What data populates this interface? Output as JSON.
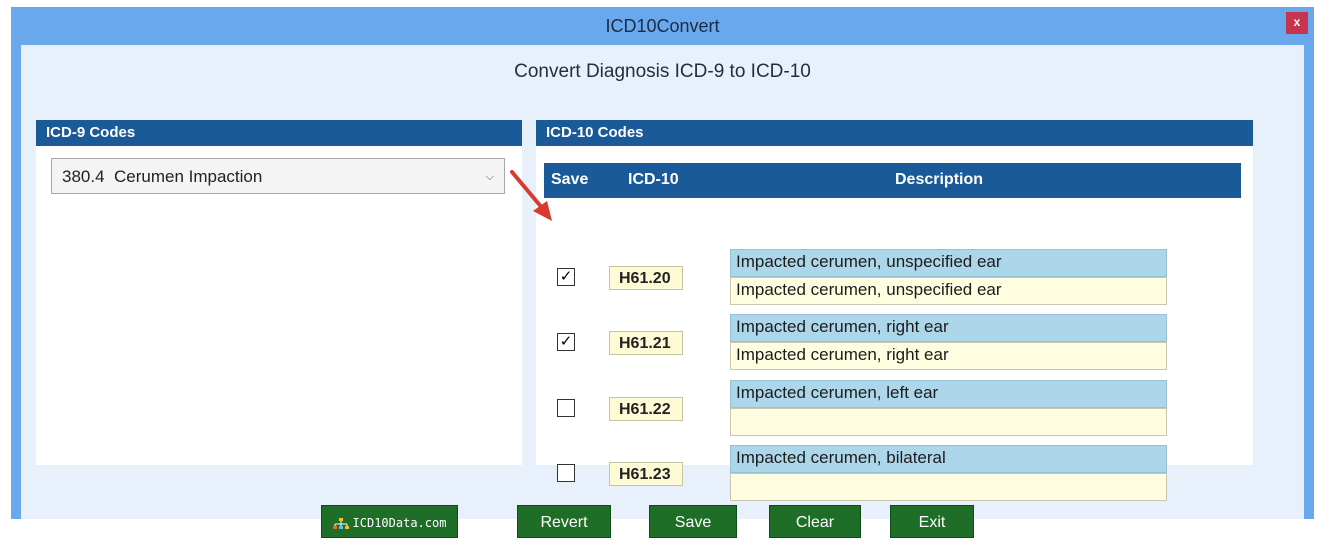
{
  "window": {
    "title": "ICD10Convert",
    "close_label": "x"
  },
  "page_heading": "Convert Diagnosis ICD-9 to ICD-10",
  "icd9_panel": {
    "header": "ICD-9 Codes",
    "selected_value": "380.4  Cerumen Impaction"
  },
  "icd10_panel": {
    "header": "ICD-10 Codes",
    "columns": [
      "Save",
      "ICD-10",
      "Description"
    ],
    "rows": [
      {
        "checked": true,
        "code": "H61.20",
        "description": "Impacted cerumen, unspecified ear",
        "edit_description": "Impacted cerumen, unspecified ear"
      },
      {
        "checked": true,
        "code": "H61.21",
        "description": "Impacted cerumen, right ear",
        "edit_description": "Impacted cerumen, right ear"
      },
      {
        "checked": false,
        "code": "H61.22",
        "description": "Impacted cerumen, left ear",
        "edit_description": ""
      },
      {
        "checked": false,
        "code": "H61.23",
        "description": "Impacted cerumen, bilateral",
        "edit_description": ""
      }
    ]
  },
  "buttons": {
    "logo_label": "ICD10Data.com",
    "revert": "Revert",
    "save": "Save",
    "clear": "Clear",
    "exit": "Exit"
  },
  "colors": {
    "titlebar": "#6aa8ee",
    "panel_header": "#1a5a98",
    "button": "#1f6e28",
    "close": "#c8334d"
  }
}
